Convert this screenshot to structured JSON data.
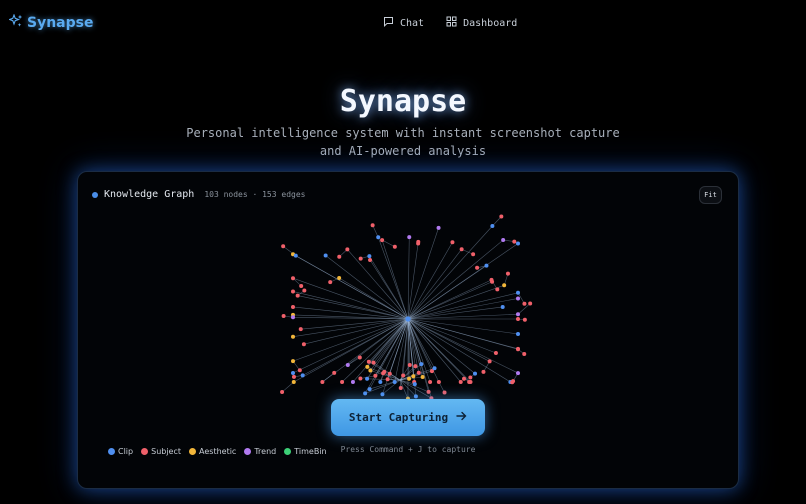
{
  "brand": {
    "name": "Synapse",
    "icon": "sparkles-icon",
    "color": "#5aaaf0"
  },
  "nav": {
    "items": [
      {
        "label": "Chat",
        "icon": "chat-bubble-icon"
      },
      {
        "label": "Dashboard",
        "icon": "grid-icon"
      }
    ]
  },
  "hero": {
    "title": "Synapse",
    "subtitle_line1": "Personal intelligence system with instant screenshot capture",
    "subtitle_line2": "and AI-powered analysis"
  },
  "graph": {
    "title": "Knowledge Graph",
    "stats": "103 nodes · 153 edges",
    "fit_label": "Fit",
    "legend": [
      {
        "label": "Clip",
        "color": "#4f8ff0"
      },
      {
        "label": "Subject",
        "color": "#f0606a"
      },
      {
        "label": "Aesthetic",
        "color": "#f2b63a"
      },
      {
        "label": "Trend",
        "color": "#b17af0"
      },
      {
        "label": "TimeBin",
        "color": "#3ccf76"
      }
    ]
  },
  "cta": {
    "label": "Start Capturing",
    "icon": "arrow-right-icon",
    "hint": "Press Command + J to capture"
  }
}
